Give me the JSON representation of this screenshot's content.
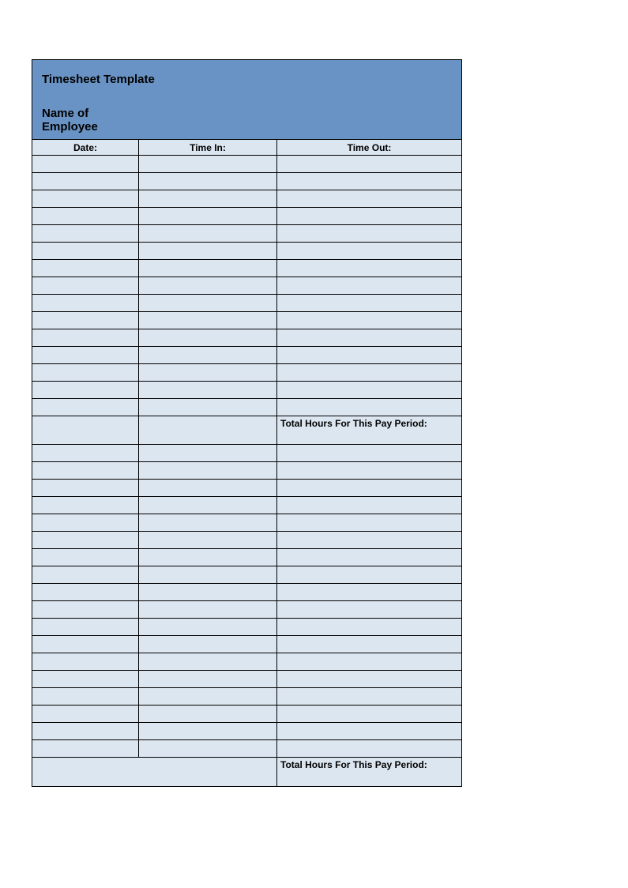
{
  "header": {
    "title": "Timesheet Template",
    "employee_label": "Name of Employee"
  },
  "columns": {
    "date": "Date:",
    "time_in": "Time In:",
    "time_out": "Time Out:"
  },
  "section1": {
    "rows": [
      {
        "date": "",
        "time_in": "",
        "time_out": ""
      },
      {
        "date": "",
        "time_in": "",
        "time_out": ""
      },
      {
        "date": "",
        "time_in": "",
        "time_out": ""
      },
      {
        "date": "",
        "time_in": "",
        "time_out": ""
      },
      {
        "date": "",
        "time_in": "",
        "time_out": ""
      },
      {
        "date": "",
        "time_in": "",
        "time_out": ""
      },
      {
        "date": "",
        "time_in": "",
        "time_out": ""
      },
      {
        "date": "",
        "time_in": "",
        "time_out": ""
      },
      {
        "date": "",
        "time_in": "",
        "time_out": ""
      },
      {
        "date": "",
        "time_in": "",
        "time_out": ""
      },
      {
        "date": "",
        "time_in": "",
        "time_out": ""
      },
      {
        "date": "",
        "time_in": "",
        "time_out": ""
      },
      {
        "date": "",
        "time_in": "",
        "time_out": ""
      },
      {
        "date": "",
        "time_in": "",
        "time_out": ""
      },
      {
        "date": "",
        "time_in": "",
        "time_out": ""
      }
    ],
    "total_label": "Total Hours For This Pay Period:"
  },
  "section2": {
    "rows": [
      {
        "date": "",
        "time_in": "",
        "time_out": ""
      },
      {
        "date": "",
        "time_in": "",
        "time_out": ""
      },
      {
        "date": "",
        "time_in": "",
        "time_out": ""
      },
      {
        "date": "",
        "time_in": "",
        "time_out": ""
      },
      {
        "date": "",
        "time_in": "",
        "time_out": ""
      },
      {
        "date": "",
        "time_in": "",
        "time_out": ""
      },
      {
        "date": "",
        "time_in": "",
        "time_out": ""
      },
      {
        "date": "",
        "time_in": "",
        "time_out": ""
      },
      {
        "date": "",
        "time_in": "",
        "time_out": ""
      },
      {
        "date": "",
        "time_in": "",
        "time_out": ""
      },
      {
        "date": "",
        "time_in": "",
        "time_out": ""
      },
      {
        "date": "",
        "time_in": "",
        "time_out": ""
      },
      {
        "date": "",
        "time_in": "",
        "time_out": ""
      },
      {
        "date": "",
        "time_in": "",
        "time_out": ""
      },
      {
        "date": "",
        "time_in": "",
        "time_out": ""
      },
      {
        "date": "",
        "time_in": "",
        "time_out": ""
      },
      {
        "date": "",
        "time_in": "",
        "time_out": ""
      },
      {
        "date": "",
        "time_in": "",
        "time_out": ""
      }
    ],
    "total_label": "Total Hours For This Pay Period:"
  }
}
